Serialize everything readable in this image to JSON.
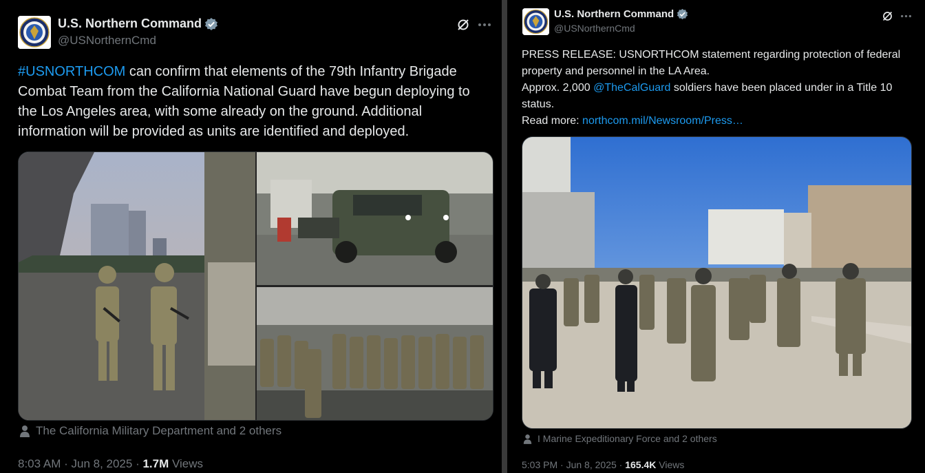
{
  "left": {
    "author": {
      "name": "U.S. Northern Command",
      "handle": "@USNorthernCmd"
    },
    "text": {
      "hashtag": "#USNORTHCOM",
      "body": " can confirm that elements of the 79th Infantry Brigade Combat Team from the California National Guard have begun deploying to the Los Angeles area, with some already on the ground. Additional information will be provided as units are identified and deployed."
    },
    "tagged": "The California Military Department and 2 others",
    "meta": {
      "time": "8:03 AM",
      "date": "Jun 8, 2025",
      "views_count": "1.7M",
      "views_label": "Views"
    }
  },
  "right": {
    "author": {
      "name": "U.S. Northern Command",
      "handle": "@USNorthernCmd"
    },
    "text": {
      "line1": "PRESS RELEASE: USNORTHCOM statement regarding protection of federal property and personnel in the LA Area.",
      "line2_pre": "Approx. 2,000 ",
      "mention": "@TheCalGuard",
      "line2_post": " soldiers have been placed under in a Title 10 status.",
      "readmore_label": "Read more: ",
      "readmore_link": "northcom.mil/Newsroom/Press…"
    },
    "tagged": "I Marine Expeditionary Force and 2 others",
    "meta": {
      "time": "5:03 PM",
      "date": "Jun 8, 2025",
      "views_count": "165.4K",
      "views_label": "Views"
    }
  },
  "separator": " · ",
  "icons": {
    "verified": "verified-badge-icon",
    "grok": "grok-icon",
    "more": "more-icon",
    "person": "person-tag-icon",
    "seal": "northcom-seal-icon"
  },
  "colors": {
    "background": "#000000",
    "text": "#e7e9ea",
    "secondary": "#71767b",
    "link": "#1d9bf0",
    "verified": "#829aab"
  }
}
